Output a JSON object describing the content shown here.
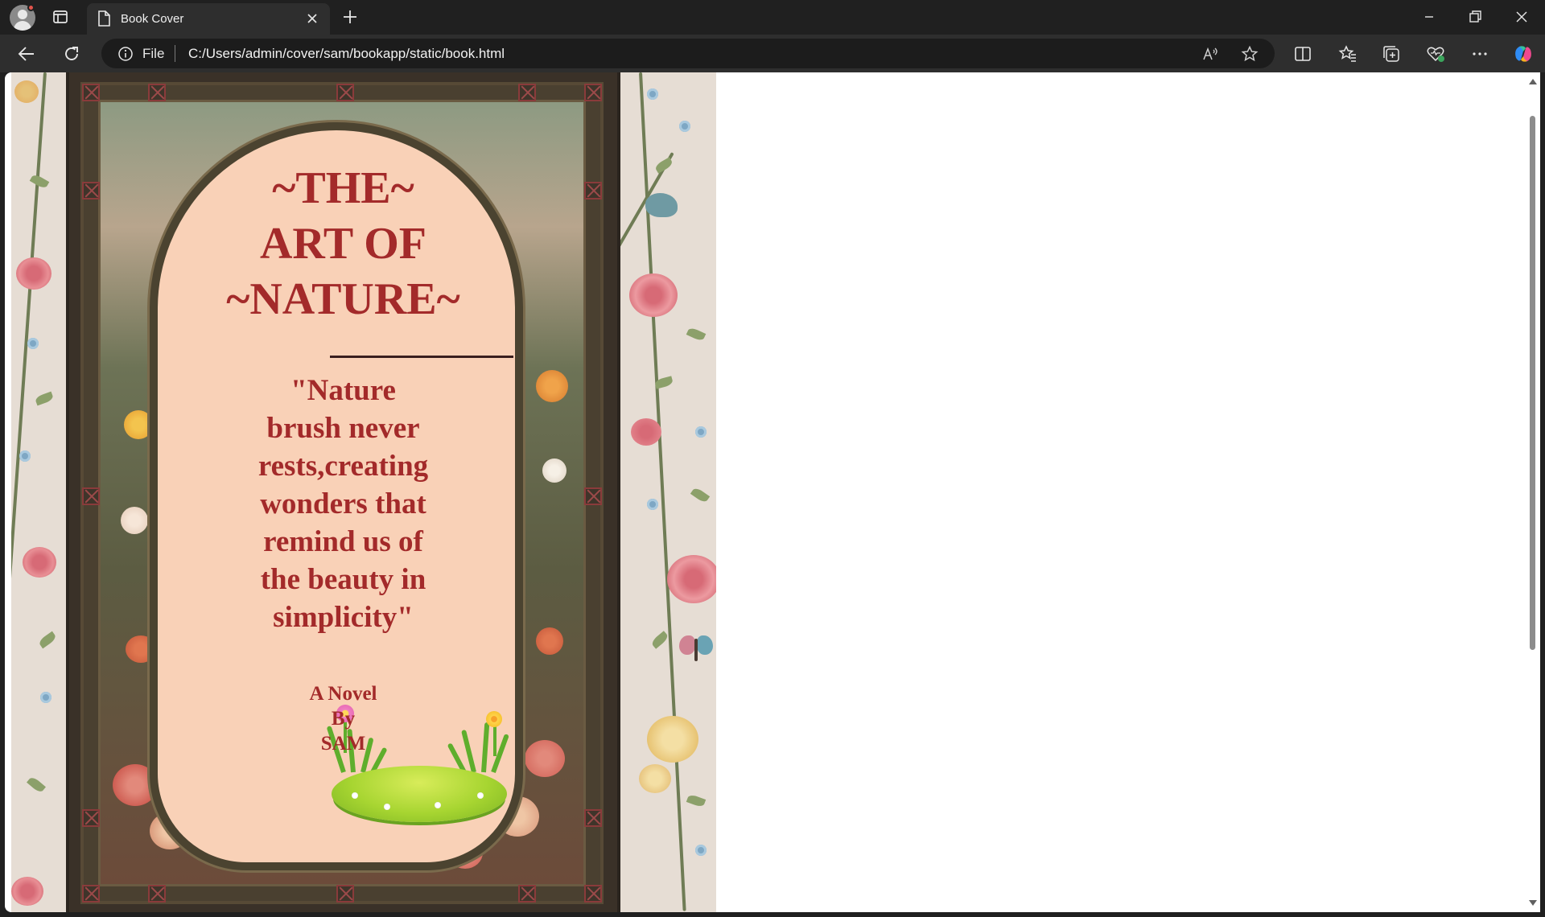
{
  "browser": {
    "tab": {
      "title": "Book Cover"
    },
    "address": {
      "scheme_label": "File",
      "url": "C:/Users/admin/cover/sam/bookapp/static/book.html"
    }
  },
  "cover": {
    "title_lines": [
      "~THE~",
      "ART OF",
      "~NATURE~"
    ],
    "quote_lines": [
      "\"Nature",
      "brush never",
      "rests,creating",
      "wonders that",
      "remind us of",
      "the beauty in",
      "simplicity\""
    ],
    "byline_lines": [
      "A Novel",
      "By",
      "SAM"
    ]
  },
  "colors": {
    "title_text": "#a32a2a",
    "arch_fill": "#f9d1b7",
    "frame": "#3a3128",
    "wallpaper": "#e6ddd4"
  }
}
